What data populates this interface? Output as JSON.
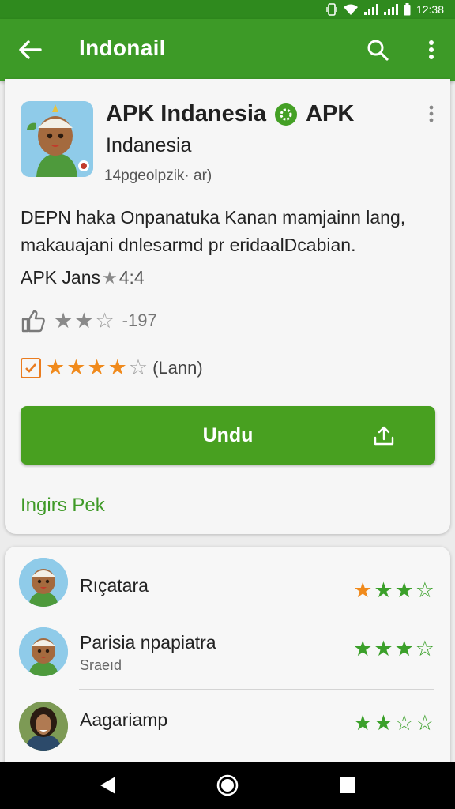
{
  "status_bar": {
    "time": "12:38"
  },
  "app_bar": {
    "title": "Indonail"
  },
  "app": {
    "title_line1": "APK Indanesia",
    "title_line1_suffix": "APK",
    "title_line2": "Indanesia",
    "meta": "14pgeolpzik· ar)",
    "description": "DEPN haka Onpanatuka Kanan mamjainn lang, makauajani dnlesarmd pr eridaalDcabian.",
    "rating_label": "APK Jans",
    "rating_value": "4:4",
    "thumb_row_text": "-197",
    "orange_row_text": "(Lann)",
    "download_label": "Undu",
    "link_text": "Ingirs Pek"
  },
  "reviews": [
    {
      "name": "Rıçatara",
      "sub": "",
      "stars_filled": 3,
      "first_star_orange": true
    },
    {
      "name": "Parisia npapiatra",
      "sub": "Sraeıd",
      "stars_filled": 3,
      "first_star_orange": false
    },
    {
      "name": "Aagariamp",
      "sub": "",
      "stars_filled": 2,
      "first_star_orange": false
    }
  ],
  "colors": {
    "primary": "#3d9a27",
    "status_bar": "#2f8a1e",
    "accent_orange": "#f08a1c",
    "button": "#48a020"
  }
}
